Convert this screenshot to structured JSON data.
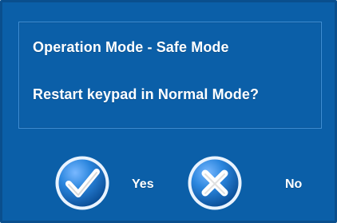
{
  "dialog": {
    "title_line": "Operation Mode - Safe Mode",
    "question": "Restart keypad in Normal Mode?",
    "buttons": {
      "yes": {
        "label": "Yes",
        "icon": "checkmark-icon"
      },
      "no": {
        "label": "No",
        "icon": "x-icon"
      }
    }
  },
  "colors": {
    "dialog_bg": "#0b5fa8",
    "panel_border": "#3f8dd2",
    "text": "#ffffff",
    "button_circle_outer": "#e9f3ff",
    "button_circle_fill": "#1e79d1"
  }
}
